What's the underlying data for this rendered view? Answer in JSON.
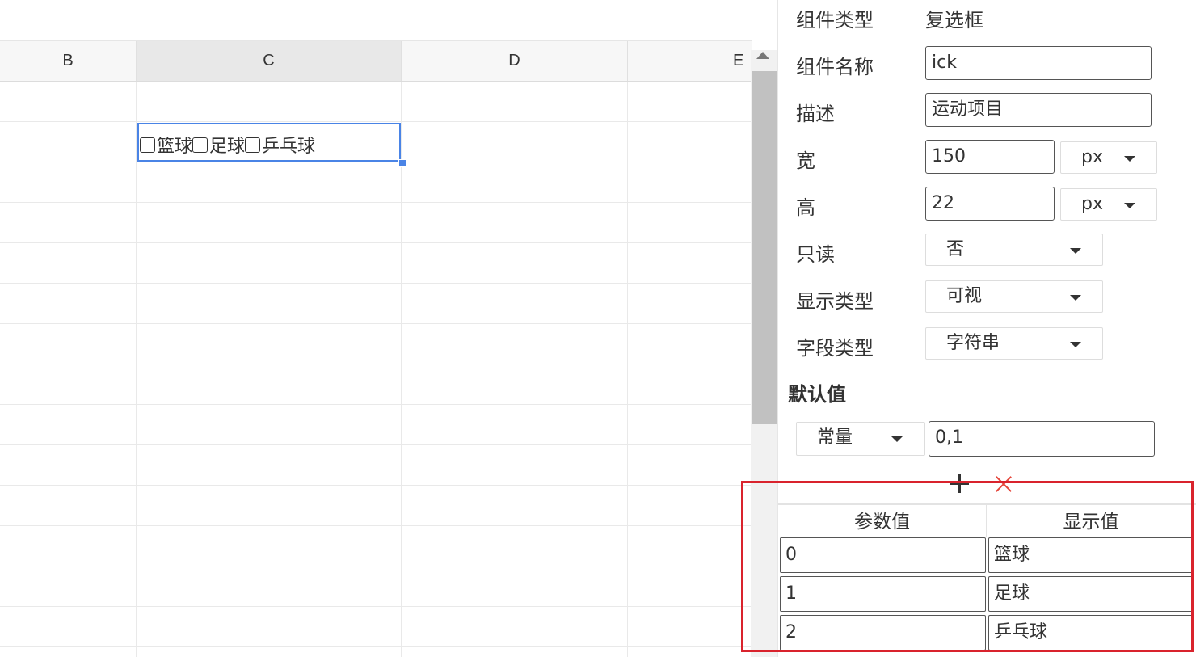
{
  "sheet": {
    "columns": [
      "B",
      "C",
      "D",
      "E"
    ],
    "cell_checkboxes": [
      "篮球",
      "足球",
      "乒乓球"
    ]
  },
  "panel": {
    "component_type_label": "组件类型",
    "component_type_value": "复选框",
    "component_name_label": "组件名称",
    "component_name_value": "ick",
    "description_label": "描述",
    "description_value": "运动项目",
    "width_label": "宽",
    "width_value": "150",
    "width_unit": "px",
    "height_label": "高",
    "height_value": "22",
    "height_unit": "px",
    "readonly_label": "只读",
    "readonly_value": "否",
    "display_type_label": "显示类型",
    "display_type_value": "可视",
    "field_type_label": "字段类型",
    "field_type_value": "字符串",
    "default_title": "默认值",
    "default_source": "常量",
    "default_value": "0,1"
  },
  "options": {
    "headers": [
      "参数值",
      "显示值"
    ],
    "rows": [
      {
        "value": "0",
        "label": "篮球"
      },
      {
        "value": "1",
        "label": "足球"
      },
      {
        "value": "2",
        "label": "乒乓球"
      }
    ]
  },
  "colors": {
    "selection": "#4a84e6",
    "highlight": "#d9232d",
    "remove": "#e5453a"
  }
}
